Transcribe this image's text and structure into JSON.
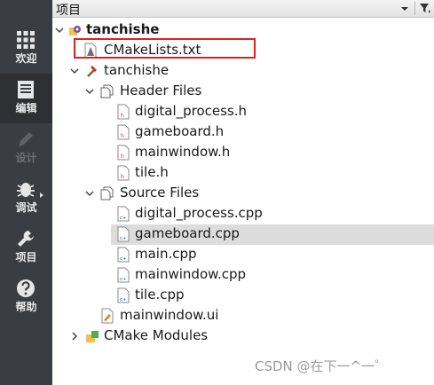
{
  "sidebar": {
    "modes": [
      {
        "label": "欢迎",
        "icon": "grid-icon",
        "state": "normal"
      },
      {
        "label": "编辑",
        "icon": "document-icon",
        "state": "active"
      },
      {
        "label": "设计",
        "icon": "pencil-icon",
        "state": "disabled"
      },
      {
        "label": "调试",
        "icon": "bug-icon",
        "state": "normal"
      },
      {
        "label": "项目",
        "icon": "wrench-icon",
        "state": "normal"
      },
      {
        "label": "帮助",
        "icon": "help-icon",
        "state": "normal"
      }
    ]
  },
  "panel": {
    "title": "项目"
  },
  "tree": {
    "project_name": "tanchishe",
    "cmakelists": "CMakeLists.txt",
    "target_name": "tanchishe",
    "header_group": "Header Files",
    "headers": [
      "digital_process.h",
      "gameboard.h",
      "mainwindow.h",
      "tile.h"
    ],
    "source_group": "Source Files",
    "sources": [
      "digital_process.cpp",
      "gameboard.cpp",
      "main.cpp",
      "mainwindow.cpp",
      "tile.cpp"
    ],
    "selected_source": "gameboard.cpp",
    "ui_file": "mainwindow.ui",
    "cmake_modules": "CMake Modules"
  },
  "watermark": "CSDN @在下一^一゜",
  "colors": {
    "sidebar_bg": "#3a3d41",
    "highlight": "#e02020",
    "selection": "#dcdcdc"
  }
}
